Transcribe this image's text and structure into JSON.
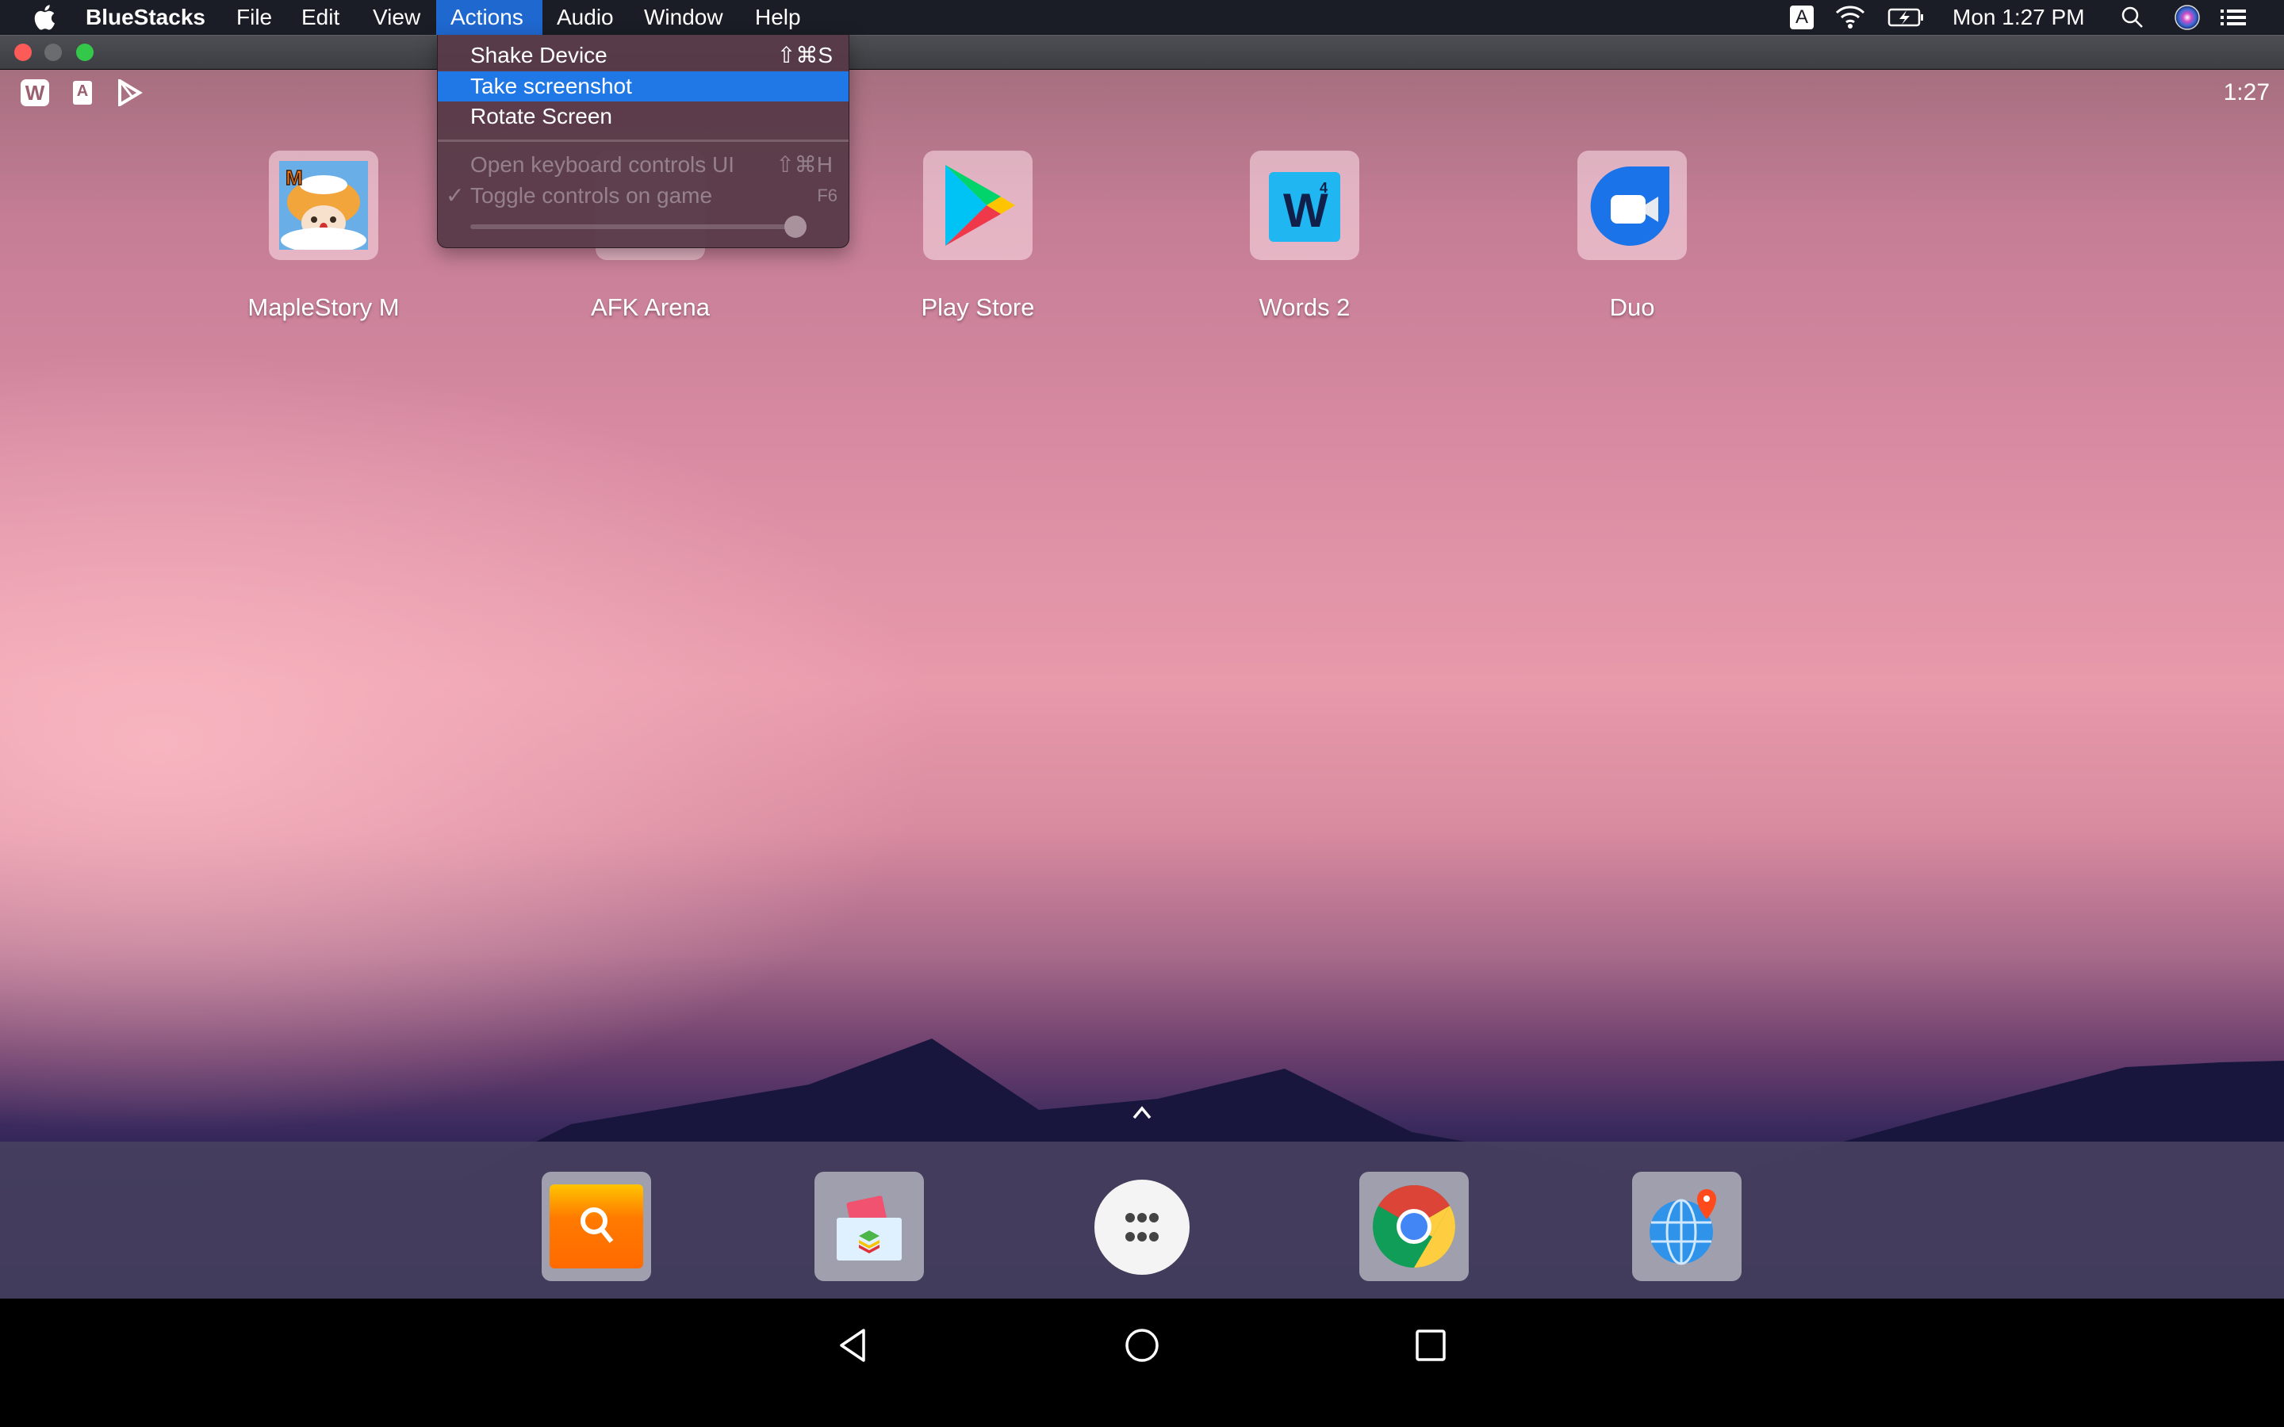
{
  "menubar": {
    "apple_icon": "apple-logo",
    "app_name": "BlueStacks",
    "items": [
      "File",
      "Edit",
      "View",
      "Actions",
      "Audio",
      "Window",
      "Help"
    ],
    "active_item": "Actions",
    "input_source": "A",
    "clock": "Mon 1:27 PM"
  },
  "actions_menu": {
    "items": [
      {
        "label": "Shake Device",
        "shortcut": "⇧⌘S",
        "enabled": true,
        "selected": false
      },
      {
        "label": "Take screenshot",
        "shortcut": "",
        "enabled": true,
        "selected": true
      },
      {
        "label": "Rotate Screen",
        "shortcut": "",
        "enabled": true,
        "selected": false
      },
      {
        "label": "Open keyboard controls UI",
        "shortcut": "⇧⌘H",
        "enabled": false,
        "selected": false
      },
      {
        "label": "Toggle controls on game",
        "shortcut": "F6",
        "enabled": false,
        "selected": false,
        "checked": true
      }
    ],
    "checkmark": "✓",
    "slider_value_fraction": 1.0
  },
  "android": {
    "status_clock": "1:27",
    "notification_icons": [
      "words-icon",
      "font-a-icon",
      "play-store-icon"
    ],
    "notification_texts": {
      "words": "W",
      "font": "A"
    },
    "home_apps": [
      {
        "label": "MapleStory M"
      },
      {
        "label": "AFK Arena"
      },
      {
        "label": "Play Store"
      },
      {
        "label": "Words 2",
        "glyph": "W",
        "superscript": "4"
      },
      {
        "label": "Duo"
      }
    ],
    "dock_apps": [
      "search-app",
      "bluestacks-media-manager",
      "all-apps",
      "chrome",
      "world-map-app"
    ],
    "nav": [
      "back",
      "home",
      "recents"
    ]
  },
  "colors": {
    "menu_highlight": "#1f78e5",
    "menubar_active": "#1f68d0",
    "traffic_close": "#fc5b57",
    "traffic_min": "#6b6c70",
    "traffic_max": "#34c84a"
  }
}
